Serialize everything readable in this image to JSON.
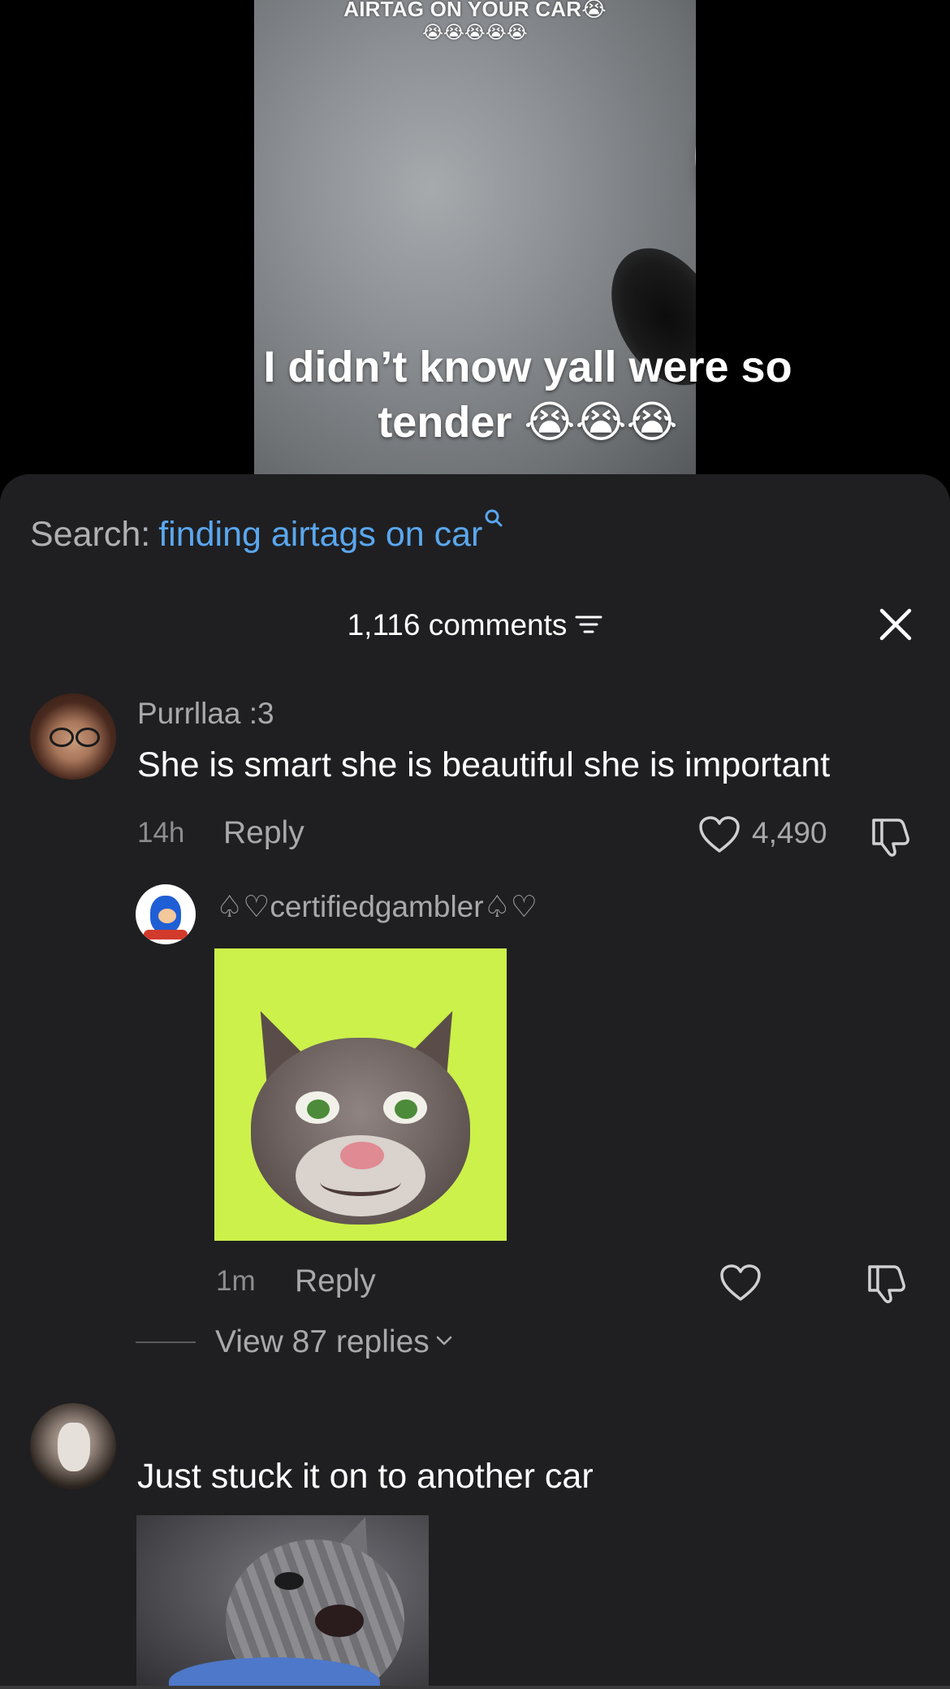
{
  "video": {
    "top_text": "AIRTAG ON YOUR CAR😭",
    "top_emojis": "😭😭😭😭😭",
    "caption": "I didn’t know yall were so tender 😭😭😭"
  },
  "search": {
    "label": "Search:",
    "query": "finding airtags on car"
  },
  "comments_header": {
    "count_label": "1,116 comments"
  },
  "comments": [
    {
      "username": "Purrllaa :3",
      "text": "She is smart she is beautiful she is important",
      "time": "14h",
      "reply_label": "Reply",
      "likes": "4,490"
    },
    {
      "username": "♤♡certifiedgambler♤♡",
      "time": "1m",
      "reply_label": "Reply",
      "view_replies": "View 87 replies"
    },
    {
      "username": "",
      "text": "Just stuck it on to another car"
    }
  ],
  "icons": {
    "search": "search-icon",
    "sort": "sort-icon",
    "close": "close-icon",
    "like": "heart-icon",
    "dislike": "thumbs-down-icon",
    "chevron": "chevron-down-icon"
  },
  "colors": {
    "accent_link": "#5aa7ef",
    "sheet_bg": "#1f1f21",
    "muted_text": "#a9a9ac"
  }
}
